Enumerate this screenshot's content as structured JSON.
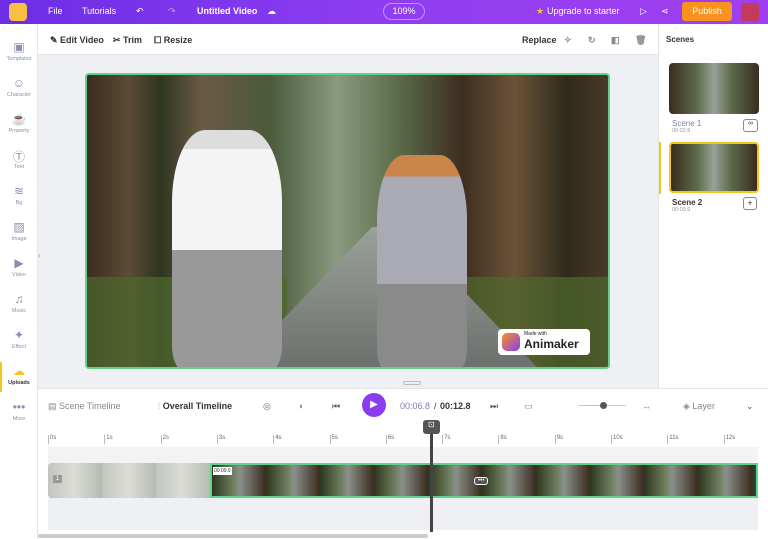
{
  "topbar": {
    "file": "File",
    "tutorials": "Tutorials",
    "title": "Untitled Video",
    "zoom": "109%",
    "upgrade": "Upgrade to starter",
    "publish": "Publish"
  },
  "toolbar": {
    "edit_video": "Edit Video",
    "trim": "Trim",
    "resize": "Resize",
    "replace": "Replace"
  },
  "sidebar": {
    "items": [
      {
        "label": "Templates",
        "icon": "clapper-icon"
      },
      {
        "label": "Character",
        "icon": "person-icon"
      },
      {
        "label": "Property",
        "icon": "cup-icon"
      },
      {
        "label": "Text",
        "icon": "text-icon"
      },
      {
        "label": "Bg",
        "icon": "layers-icon"
      },
      {
        "label": "Image",
        "icon": "image-icon"
      },
      {
        "label": "Video",
        "icon": "video-icon"
      },
      {
        "label": "Music",
        "icon": "music-icon"
      },
      {
        "label": "Effect",
        "icon": "sparkle-icon"
      },
      {
        "label": "Uploads",
        "icon": "cloud-upload-icon"
      },
      {
        "label": "More",
        "icon": "more-icon"
      }
    ],
    "active": "Uploads"
  },
  "video": {
    "watermark_small": "Made with",
    "watermark": "Animaker"
  },
  "scenes": {
    "title": "Scenes",
    "items": [
      {
        "name": "Scene 1",
        "duration": "00:02.9"
      },
      {
        "name": "Scene 2",
        "duration": "00:09.9",
        "selected": true
      }
    ]
  },
  "timeline": {
    "scene_timeline": "Scene Timeline",
    "overall_timeline": "Overall Timeline",
    "current": "00:06.8",
    "separator": "/",
    "total": "00:12.8",
    "layer": "Layer",
    "ticks": [
      "0s",
      "1s",
      "2s",
      "3s",
      "4s",
      "5s",
      "6s",
      "7s",
      "8s",
      "9s",
      "10s",
      "11s",
      "12s"
    ],
    "clip1_index": "1",
    "clip2_duration": "00:09.9",
    "playhead_seconds": 6.8,
    "zoom_level": 0.5
  },
  "colors": {
    "accent": "#8a3df0",
    "publish": "#f7931e",
    "selected": "#f5c518",
    "clip_border": "#5fd38b"
  }
}
